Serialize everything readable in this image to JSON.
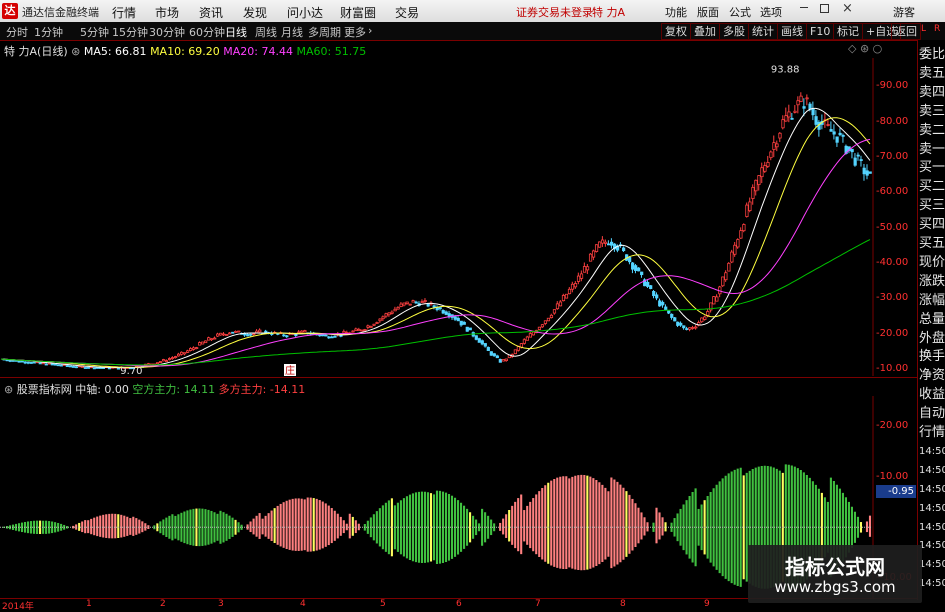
{
  "menubar": {
    "app_title": "通达信金融终端",
    "items": [
      "行情",
      "市场",
      "资讯",
      "发现",
      "问小达",
      "财富圈",
      "交易"
    ],
    "login_status": "证券交易未登录",
    "stock_name": "特 力A",
    "right_items": [
      "功能",
      "版面",
      "公式",
      "选项"
    ],
    "guest": "游客"
  },
  "toolbar": {
    "periods": [
      "分时",
      "1分钟",
      "5分钟",
      "15分钟",
      "30分钟",
      "60分钟",
      "日线",
      "周线",
      "月线",
      "多周期",
      "更多"
    ],
    "selected": "日线",
    "right_buttons": [
      "复权",
      "叠加",
      "多股",
      "统计",
      "画线",
      "F10",
      "标记",
      "+自选",
      "返回"
    ]
  },
  "price_legend": {
    "stock": "特 力A",
    "period": "(日线)",
    "ma5": "MA5: 66.81",
    "ma10": "MA10: 69.20",
    "ma20": "MA20: 74.44",
    "ma60": "MA60: 51.75"
  },
  "price_annotations": {
    "high": "93.88",
    "low": "9.70",
    "event_marker": "庄"
  },
  "price_axis": {
    "labels": [
      "90.00",
      "80.00",
      "70.00",
      "60.00",
      "50.00",
      "40.00",
      "30.00",
      "20.00",
      "10.00"
    ]
  },
  "indicator_legend": {
    "name": "股票指标网",
    "mid_label": "中轴: 0.00",
    "bull_label": "空方主力: 14.11",
    "bear_label": "多方主力: -14.11"
  },
  "indicator_axis": {
    "labels": [
      "20.00",
      "10.00",
      "-10.00"
    ],
    "current": "-0.95"
  },
  "right_panel": {
    "items": [
      "委比",
      "卖五",
      "卖四",
      "卖三",
      "卖二",
      "卖一",
      "买一",
      "买二",
      "买三",
      "买四",
      "买五",
      "现价",
      "涨跌",
      "涨幅",
      "总量",
      "外盘",
      "换手",
      "净资",
      "收益",
      "自动",
      "行情",
      "14:50",
      "14:50",
      "14:50",
      "14:50",
      "14:50",
      "14:50",
      "14:50",
      "14:50"
    ],
    "corner_top": "L",
    "corner_bottom": "R"
  },
  "time_axis": {
    "labels": [
      "2014年",
      "1",
      "2",
      "3",
      "4",
      "5",
      "6",
      "7",
      "8",
      "9"
    ]
  },
  "watermark": {
    "line1": "指标公式网",
    "line2": "www.zbgs3.com"
  },
  "colors": {
    "background": "#000000",
    "up": "#ff4040",
    "down": "#54d4ff",
    "ma5": "#ffffff",
    "ma10": "#ffff40",
    "ma20": "#ff40ff",
    "ma60": "#00c000",
    "bull_hist": "#ff8080",
    "bear_hist": "#40c040",
    "axis": "#ff3030"
  },
  "chart_data": [
    {
      "type": "candlestick",
      "title": "特 力A (日线)",
      "ylim": [
        8,
        98
      ],
      "series": [
        {
          "name": "MA5",
          "color": "#ffffff"
        },
        {
          "name": "MA10",
          "color": "#ffff40"
        },
        {
          "name": "MA20",
          "color": "#ff40ff"
        },
        {
          "name": "MA60",
          "color": "#00c000"
        }
      ],
      "close": [
        12.8,
        12.4,
        12.1,
        11.8,
        11.5,
        11.2,
        10.9,
        10.6,
        10.5,
        10.4,
        10.4,
        10.3,
        10.5,
        11.0,
        11.6,
        12.4,
        13.5,
        14.8,
        16.5,
        18.2,
        19.5,
        20.5,
        20.2,
        19.8,
        20.6,
        20.1,
        19.6,
        20.0,
        20.4,
        19.8,
        19.3,
        19.7,
        20.3,
        21.0,
        22.5,
        24.5,
        26.5,
        28.2,
        29.0,
        28.6,
        27.5,
        26.0,
        24.0,
        21.0,
        18.0,
        14.5,
        12.0,
        14.0,
        17.5,
        20.5,
        23.5,
        27.0,
        31.0,
        35.0,
        40.0,
        45.0,
        46.5,
        44.0,
        40.0,
        35.5,
        31.0,
        27.0,
        23.5,
        21.0,
        22.5,
        26.0,
        32.0,
        40.0,
        49.0,
        58.0,
        66.0,
        73.0,
        80.0,
        84.0,
        86.0,
        81.0,
        78.0,
        76.0,
        72.0,
        68.0,
        64.0
      ]
    },
    {
      "type": "bar",
      "title": "股票指标网",
      "ylim": [
        -14,
        26
      ],
      "series": [
        {
          "name": "空方主力",
          "color": "#40c040"
        },
        {
          "name": "多方主力",
          "color": "#ff8080"
        }
      ]
    }
  ]
}
